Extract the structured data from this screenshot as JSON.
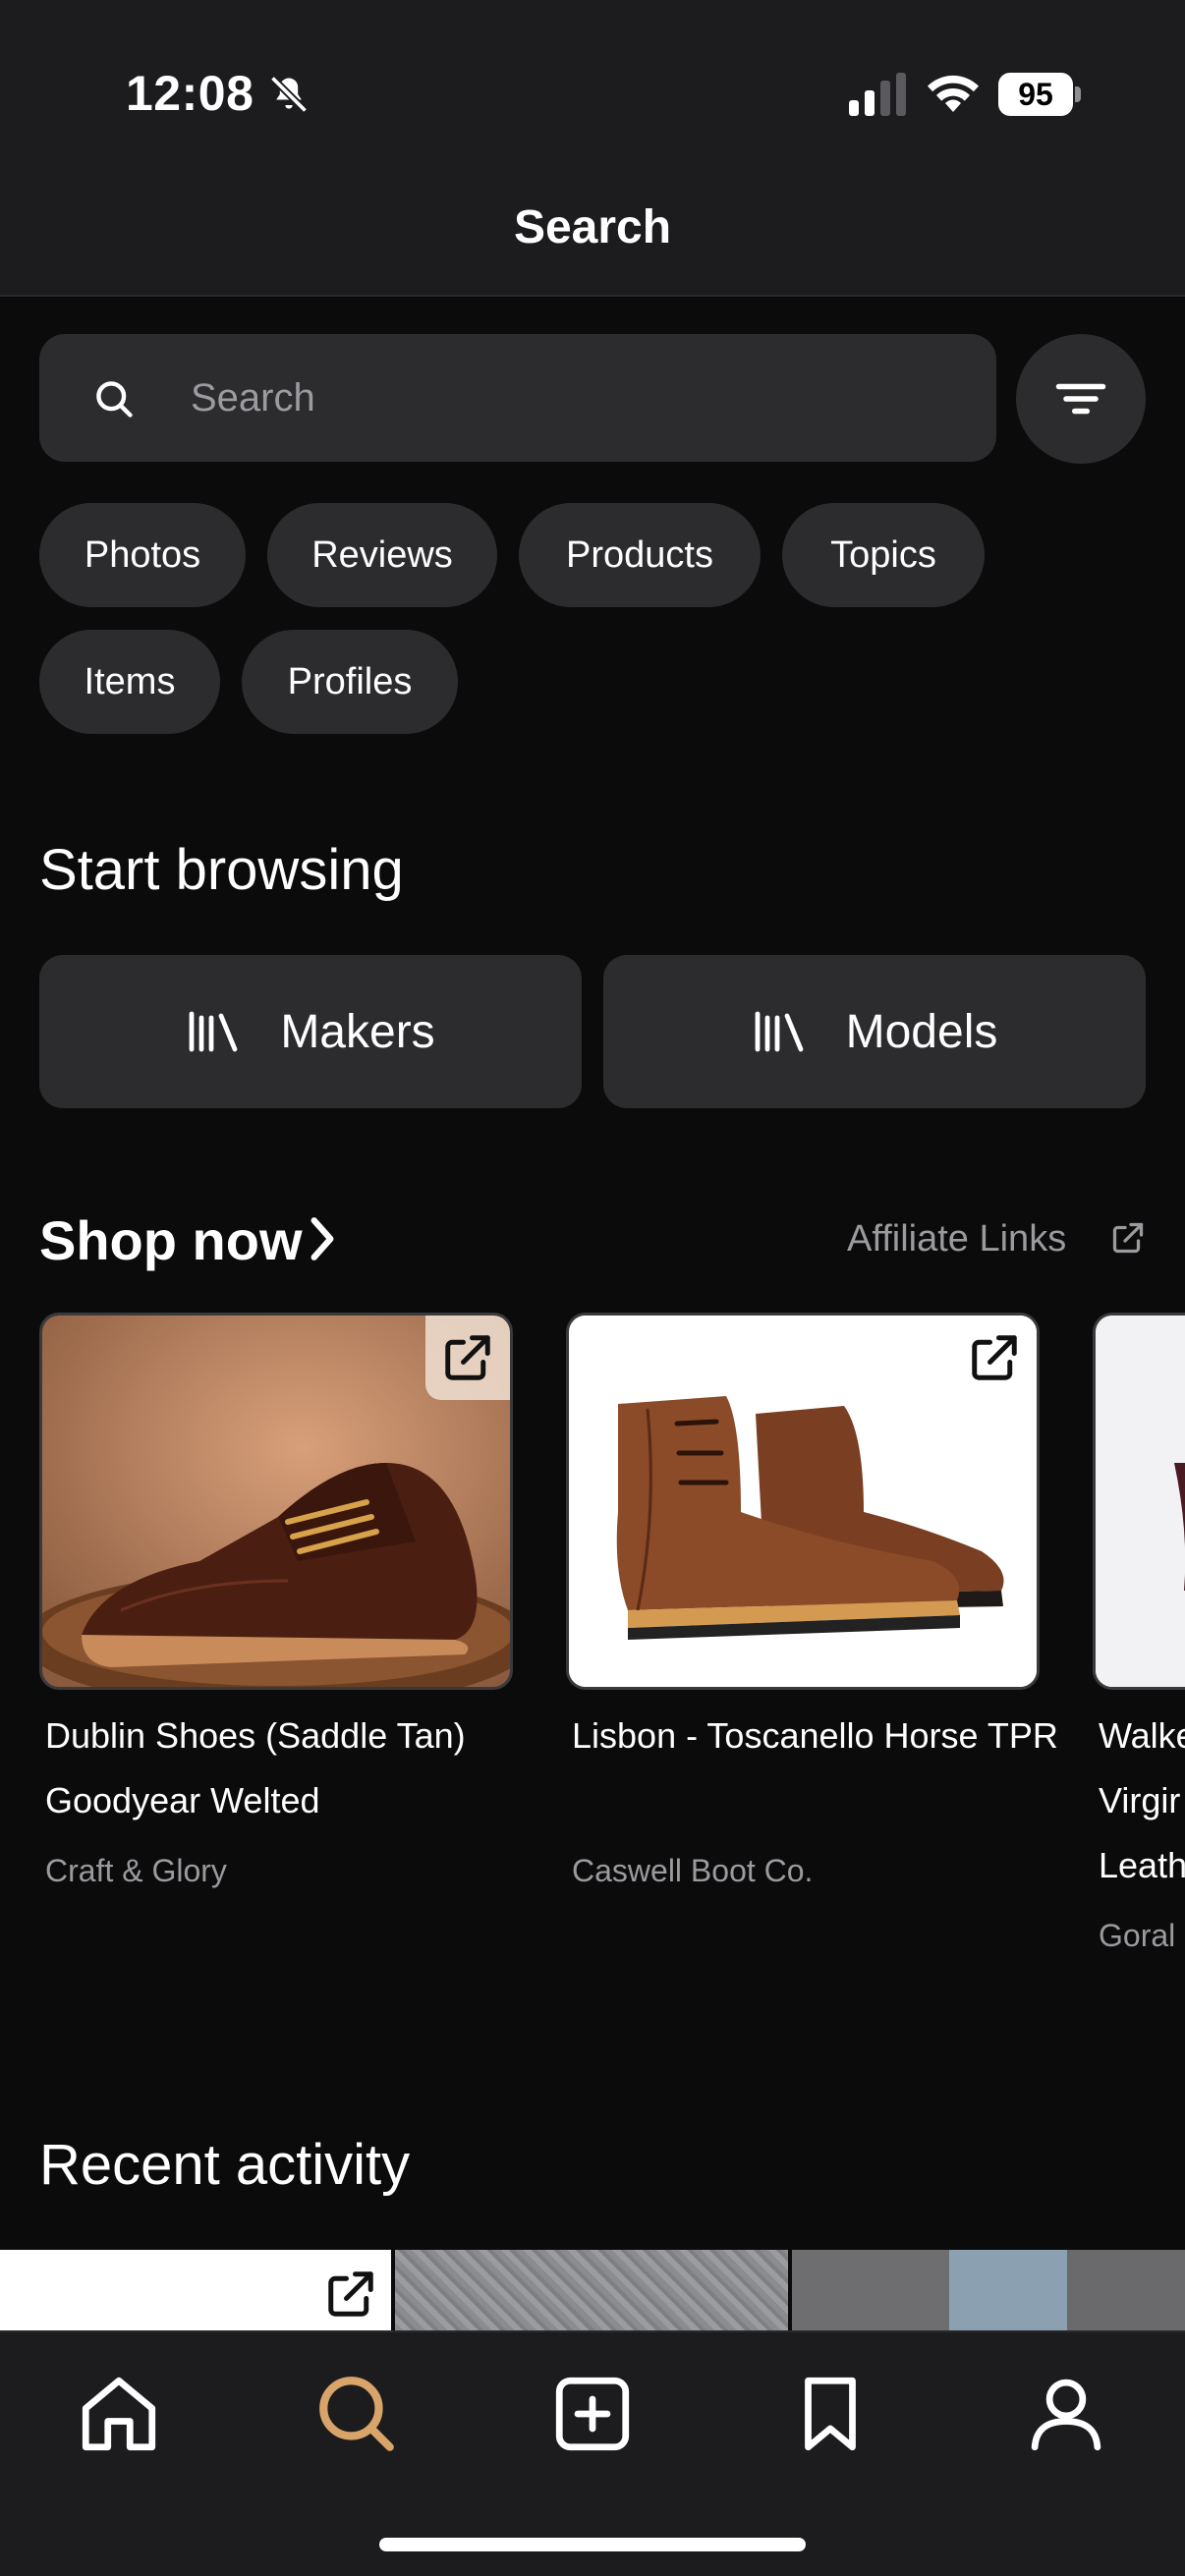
{
  "status_bar": {
    "time": "12:08",
    "battery": "95"
  },
  "header": {
    "title": "Search"
  },
  "search": {
    "placeholder": "Search"
  },
  "chips": [
    "Photos",
    "Reviews",
    "Products",
    "Topics",
    "Items",
    "Profiles"
  ],
  "browse": {
    "title": "Start browsing",
    "makers_label": "Makers",
    "models_label": "Models"
  },
  "shop": {
    "title": "Shop now",
    "affiliate_label": "Affiliate Links",
    "products": [
      {
        "name": "Dublin Shoes (Saddle Tan) Goodyear Welted",
        "brand": "Craft & Glory"
      },
      {
        "name": "Lisbon - Toscanello Horse TPR",
        "brand": "Caswell Boot Co."
      },
      {
        "name": "Walke Virgir Leath",
        "brand": "Goral"
      }
    ]
  },
  "recent": {
    "title": "Recent activity"
  },
  "nav": [
    "home-icon",
    "search-icon",
    "add-icon",
    "bookmark-icon",
    "profile-icon"
  ],
  "colors": {
    "accent": "#d9a46a",
    "background": "#0b0b0b",
    "surface": "#2c2c2e"
  }
}
